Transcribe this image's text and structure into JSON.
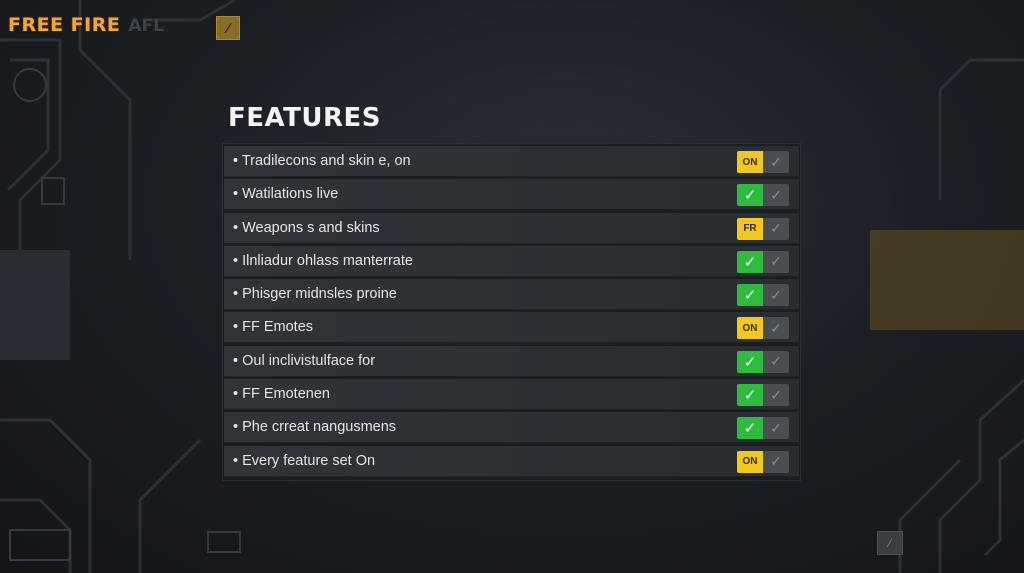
{
  "header": {
    "brand": "FREE FIRE",
    "suffix": "AFL"
  },
  "icons": {
    "badge": "⁄",
    "check": "✓",
    "corner": "⁄"
  },
  "features": {
    "title": "FEATURES",
    "items": [
      {
        "label": "• Tradilecons and skin e, on",
        "state_text": "ON",
        "state_color": "#f2c81c"
      },
      {
        "label": "• Watilations live",
        "state_text": "✓",
        "state_color": "#2ebc3e"
      },
      {
        "label": "• Weapons s and skins",
        "state_text": "FR",
        "state_color": "#f2c81c"
      },
      {
        "label": "• Ilnliadur ohlass manterrate",
        "state_text": "✓",
        "state_color": "#2ebc3e"
      },
      {
        "label": "• Phisger midnsles proine",
        "state_text": "✓",
        "state_color": "#2ebc3e"
      },
      {
        "label": "• FF Emotes",
        "state_text": "ON",
        "state_color": "#f2c81c"
      },
      {
        "label": "• Oul inclivistulface for",
        "state_text": "✓",
        "state_color": "#2ebc3e"
      },
      {
        "label": "• FF Emotenen",
        "state_text": "✓",
        "state_color": "#2ebc3e"
      },
      {
        "label": "• Phe crreat nangusmens",
        "state_text": "✓",
        "state_color": "#2ebc3e"
      },
      {
        "label": "• Every feature set On",
        "state_text": "ON",
        "state_color": "#f2c81c"
      }
    ]
  },
  "colors": {
    "brand": "#f0a63a",
    "toggle_yellow": "#f2c81c",
    "toggle_green": "#2ebc3e",
    "toggle_off": "#4a4d52"
  }
}
